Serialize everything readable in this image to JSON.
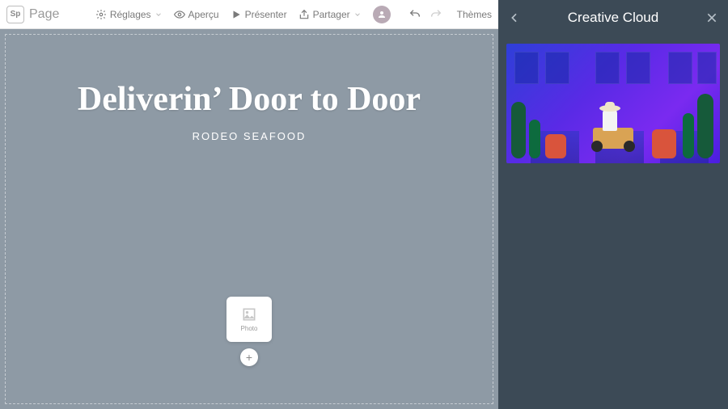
{
  "brand": {
    "logo_text": "Sp",
    "name": "Page"
  },
  "toolbar": {
    "settings": "Réglages",
    "preview": "Aperçu",
    "present": "Présenter",
    "share": "Partager",
    "themes": "Thèmes"
  },
  "canvas": {
    "title": "Deliverin’ Door to Door",
    "subtitle": "RODEO SEAFOOD",
    "photo_label": "Photo"
  },
  "side_panel": {
    "title": "Creative Cloud"
  }
}
